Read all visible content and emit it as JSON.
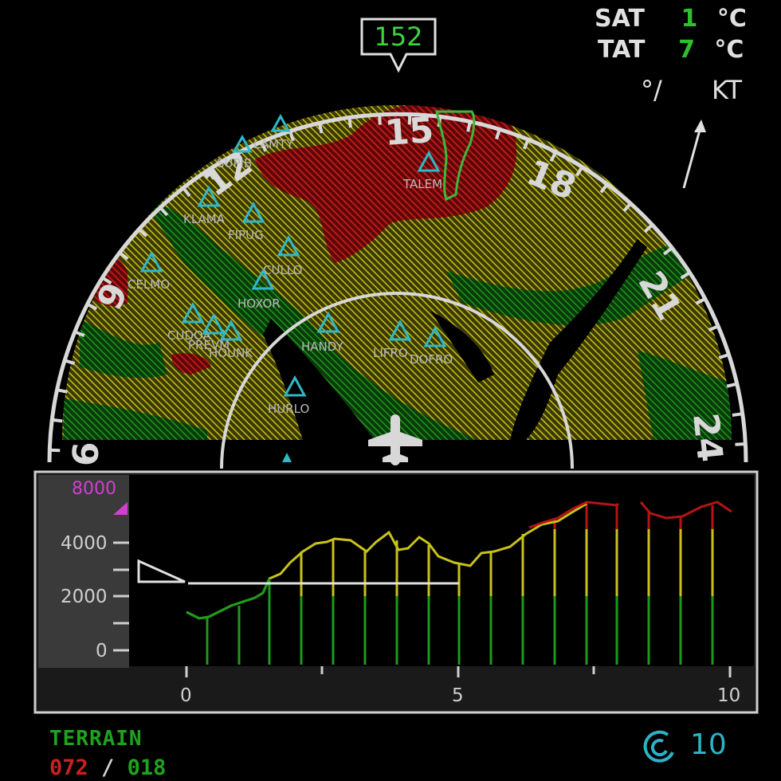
{
  "heading_bug": "152",
  "sat": {
    "label": "SAT",
    "value": "1",
    "unit": "°C"
  },
  "tat": {
    "label": "TAT",
    "value": "7",
    "unit": "°C"
  },
  "wind": {
    "dir_unit": "°/",
    "speed_unit": "KT"
  },
  "compass_labels": [
    "15",
    "18",
    "21",
    "24",
    "9",
    "12",
    "6"
  ],
  "waypoints": [
    "LAMTY",
    "SUPIB",
    "TALEM",
    "KLAMA",
    "FIPUG",
    "CELMO",
    "CULLO",
    "HOXOR",
    "CUDOA",
    "PREVM",
    "HOUNK",
    "HANDY",
    "LIFRO",
    "DOFRO",
    "HURLO"
  ],
  "profile": {
    "alt_top": "8000",
    "y_ticks": [
      "4000",
      "2000",
      "0"
    ],
    "x_ticks": [
      "0",
      "5",
      "10"
    ]
  },
  "terrain": {
    "label": "TERRAIN",
    "high": "072",
    "sep": "/",
    "low": "018"
  },
  "range": {
    "value": "10",
    "icon": "range-ring-icon"
  },
  "colors": {
    "yellow": "#c9c21a",
    "red": "#b51414",
    "green": "#1d9a1d",
    "cyan": "#2fb8c8",
    "magenta": "#d040d0"
  }
}
